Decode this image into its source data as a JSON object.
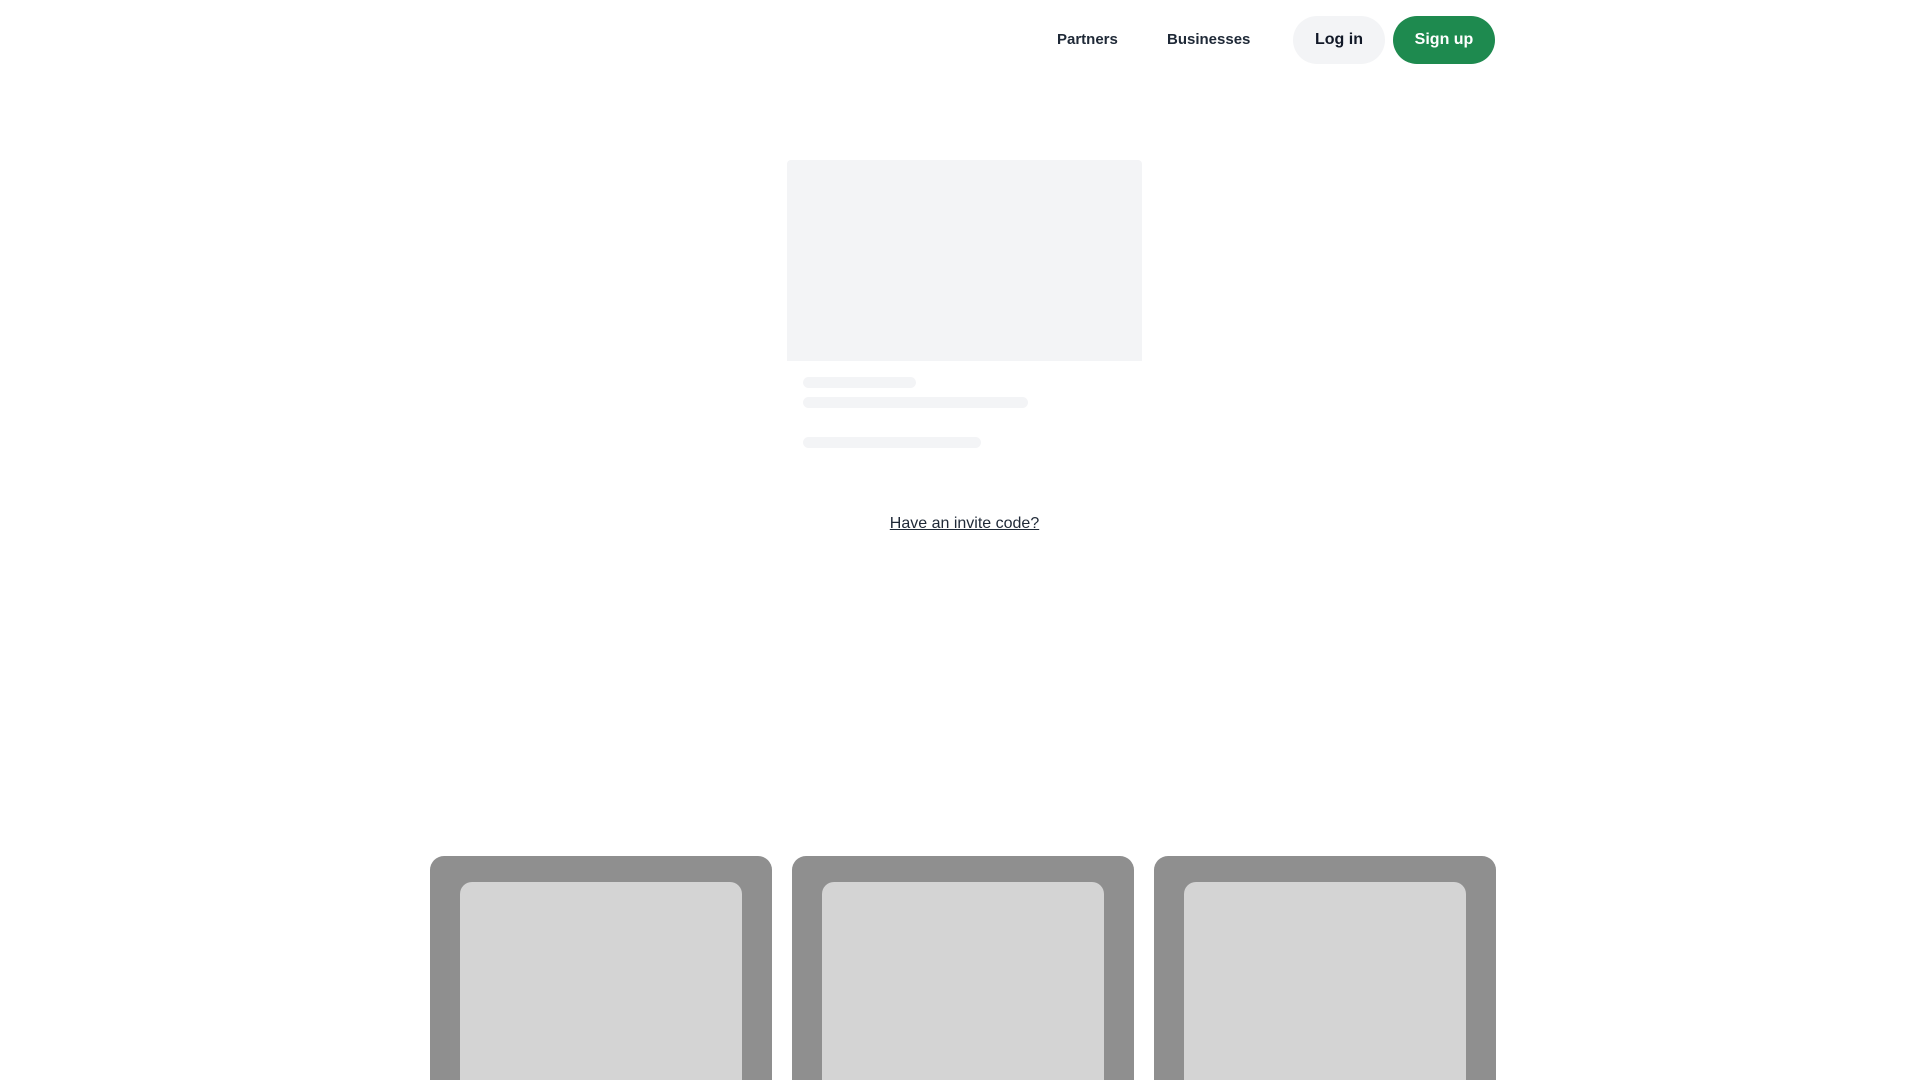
{
  "header": {
    "nav_links": [
      {
        "label": "Partners"
      },
      {
        "label": "Businesses"
      }
    ],
    "login_label": "Log in",
    "signup_label": "Sign up"
  },
  "main": {
    "invite_link_label": "Have an invite code?"
  },
  "colors": {
    "signup_bg": "#1e8a4f",
    "login_bg": "#f3f4f6",
    "skeleton": "#f3f4f6",
    "tile_outer": "#8f8f8f",
    "tile_inner": "#d4d4d4"
  }
}
